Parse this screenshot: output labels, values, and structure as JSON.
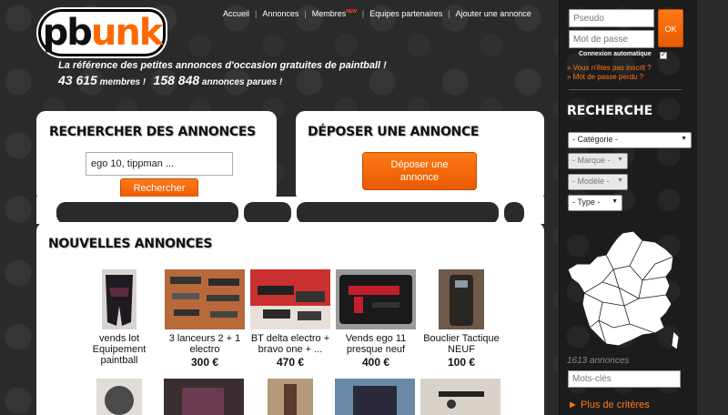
{
  "brand": {
    "logo_text_dark": "pb",
    "logo_text_accent": "unk"
  },
  "nav": {
    "items": [
      "Accueil",
      "Annonces",
      "Membres",
      "Equipes partenaires",
      "Ajouter une annonce"
    ],
    "new_badge": "NEW"
  },
  "header": {
    "tagline": "La référence des petites annonces d'occasion gratuites de paintball !",
    "members_count": "43 615",
    "members_label": "membres !",
    "ads_count": "158 848",
    "ads_label": "annonces parues !"
  },
  "search": {
    "title": "RECHERCHER DES ANNONCES",
    "input_value": "ego 10, tippman ...",
    "button_label": "Rechercher"
  },
  "post": {
    "title": "DÉPOSER UNE ANNONCE",
    "button_line1": "Déposer une",
    "button_line2": "annonce"
  },
  "news": {
    "title": "NOUVELLES ANNONCES",
    "items": [
      {
        "title": "vends lot Equipement paintball",
        "price": ""
      },
      {
        "title": "3 lanceurs 2 + 1 electro",
        "price": "300 €"
      },
      {
        "title": "BT delta electro + bravo one + ...",
        "price": "470 €"
      },
      {
        "title": "Vends ego 11 presque neuf",
        "price": "400 €"
      },
      {
        "title": "Bouclier Tactique NEUF",
        "price": "100 €"
      }
    ]
  },
  "login": {
    "username_placeholder": "Pseudo",
    "password_placeholder": "Mot de passe",
    "ok_label": "OK",
    "auto_label": "Connexion automatique",
    "register_link": "» Vous n'êtes pas inscrit ?",
    "lost_password_link": "» Mot de passe perdu ?"
  },
  "sidebar_search": {
    "title": "RECHERCHE",
    "category": "- Catégorie -",
    "brand": "- Marque -",
    "model": "- Modèle -",
    "type": "- Type -",
    "ads_count": "1613 annonces",
    "keywords_placeholder": "Mots-clés",
    "more_criteria": "► Plus de critères"
  },
  "colors": {
    "accent": "#ff6a00",
    "background": "#2a2a2a",
    "panel": "#ffffff"
  }
}
